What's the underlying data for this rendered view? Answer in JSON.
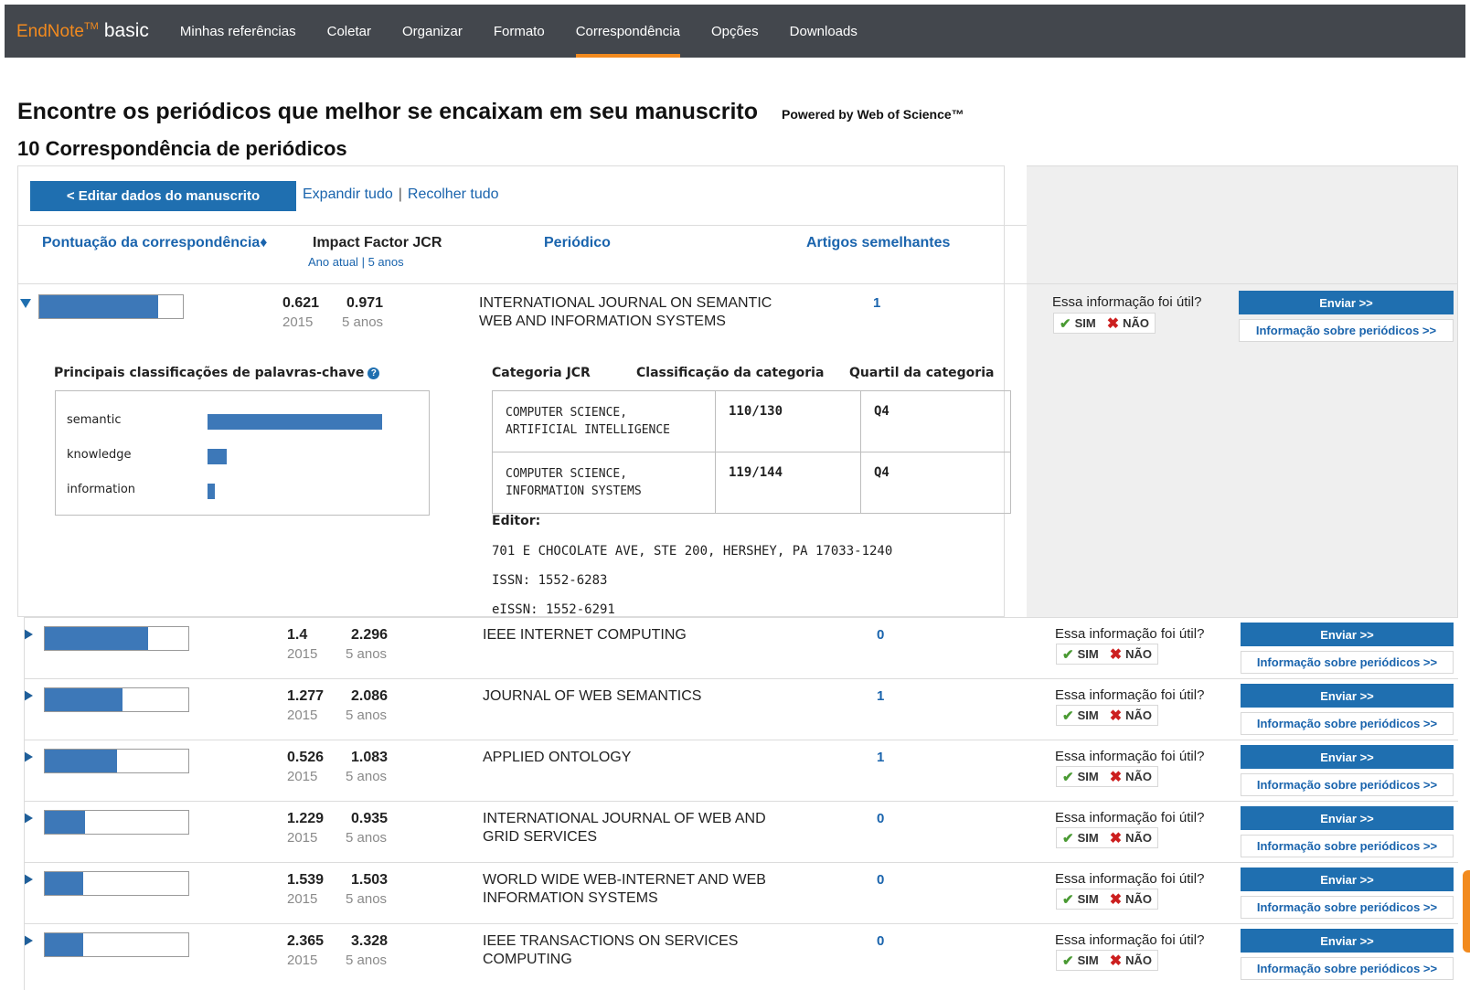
{
  "nav": {
    "brand": "EndNote",
    "brand_tm": "TM",
    "brand_edition": "basic",
    "items": [
      {
        "label": "Minhas referências"
      },
      {
        "label": "Coletar"
      },
      {
        "label": "Organizar"
      },
      {
        "label": "Formato"
      },
      {
        "label": "Correspondência",
        "active": true
      },
      {
        "label": "Opções"
      },
      {
        "label": "Downloads"
      }
    ]
  },
  "header": {
    "title": "Encontre os periódicos que melhor se encaixam em seu manuscrito",
    "powered_by": "Powered by Web of Science™",
    "subtitle": "10 Correspondência de periódicos"
  },
  "toolbar": {
    "edit_label": "< Editar dados do manuscrito",
    "expand_all": "Expandir tudo",
    "separator": "|",
    "collapse_all": "Recolher tudo"
  },
  "columns": {
    "score": "Pontuação da correspondência♦",
    "impact": "Impact Factor JCR",
    "impact_current": "Ano atual",
    "impact_sep": "|",
    "impact_5y": "5 anos",
    "journal": "Periódico",
    "similar": "Artigos semelhantes"
  },
  "feedback": {
    "question": "Essa informação foi útil?",
    "yes": "SIM",
    "no": "NÃO",
    "send": "Enviar >>",
    "journal_info": "Informação sobre periódicos >>"
  },
  "expanded": {
    "score_fraction": 0.83,
    "if_current": "0.621",
    "if_5y": "0.971",
    "year": "2015",
    "five_years": "5 anos",
    "journal_line1": "INTERNATIONAL JOURNAL ON SEMANTIC",
    "journal_line2": "WEB AND INFORMATION SYSTEMS",
    "similar": "1",
    "keywords_title": "Principais classificações de palavras-chave",
    "keywords": [
      {
        "word": "semantic",
        "weight": 1.0
      },
      {
        "word": "knowledge",
        "weight": 0.11
      },
      {
        "word": "information",
        "weight": 0.04
      }
    ],
    "category_headers": {
      "category": "Categoria JCR",
      "rank": "Classificação da categoria",
      "quartile": "Quartil da categoria"
    },
    "categories": [
      {
        "line1": "COMPUTER SCIENCE,",
        "line2": "ARTIFICIAL INTELLIGENCE",
        "rank": "110/130",
        "quartile": "Q4"
      },
      {
        "line1": "COMPUTER SCIENCE,",
        "line2": "INFORMATION SYSTEMS",
        "rank": "119/144",
        "quartile": "Q4"
      }
    ],
    "publisher_label": "Editor:",
    "publisher_address": "701 E CHOCOLATE AVE, STE 200, HERSHEY, PA 17033-1240",
    "issn": "ISSN: 1552-6283",
    "eissn": "eISSN: 1552-6291"
  },
  "rows": [
    {
      "score_fraction": 0.72,
      "if_current": "1.4",
      "if_5y": "2.296",
      "year": "2015",
      "five_years": "5 anos",
      "journal_line1": "IEEE INTERNET COMPUTING",
      "journal_line2": "",
      "similar": "0"
    },
    {
      "score_fraction": 0.54,
      "if_current": "1.277",
      "if_5y": "2.086",
      "year": "2015",
      "five_years": "5 anos",
      "journal_line1": "JOURNAL OF WEB SEMANTICS",
      "journal_line2": "",
      "similar": "1"
    },
    {
      "score_fraction": 0.5,
      "if_current": "0.526",
      "if_5y": "1.083",
      "year": "2015",
      "five_years": "5 anos",
      "journal_line1": "APPLIED ONTOLOGY",
      "journal_line2": "",
      "similar": "1"
    },
    {
      "score_fraction": 0.28,
      "if_current": "1.229",
      "if_5y": "0.935",
      "year": "2015",
      "five_years": "5 anos",
      "journal_line1": "INTERNATIONAL JOURNAL OF WEB AND",
      "journal_line2": "GRID SERVICES",
      "similar": "0"
    },
    {
      "score_fraction": 0.27,
      "if_current": "1.539",
      "if_5y": "1.503",
      "year": "2015",
      "five_years": "5 anos",
      "journal_line1": "WORLD WIDE WEB-INTERNET AND WEB",
      "journal_line2": "INFORMATION SYSTEMS",
      "similar": "0"
    },
    {
      "score_fraction": 0.27,
      "if_current": "2.365",
      "if_5y": "3.328",
      "year": "2015",
      "five_years": "5 anos",
      "journal_line1": "IEEE TRANSACTIONS ON SERVICES",
      "journal_line2": "COMPUTING",
      "similar": "0"
    }
  ],
  "colors": {
    "nav_bg": "#43474d",
    "accent_orange": "#f28a1e",
    "primary_blue": "#1f6fb0",
    "bar_blue": "#3d78b8",
    "link_blue": "#1a64ad"
  }
}
